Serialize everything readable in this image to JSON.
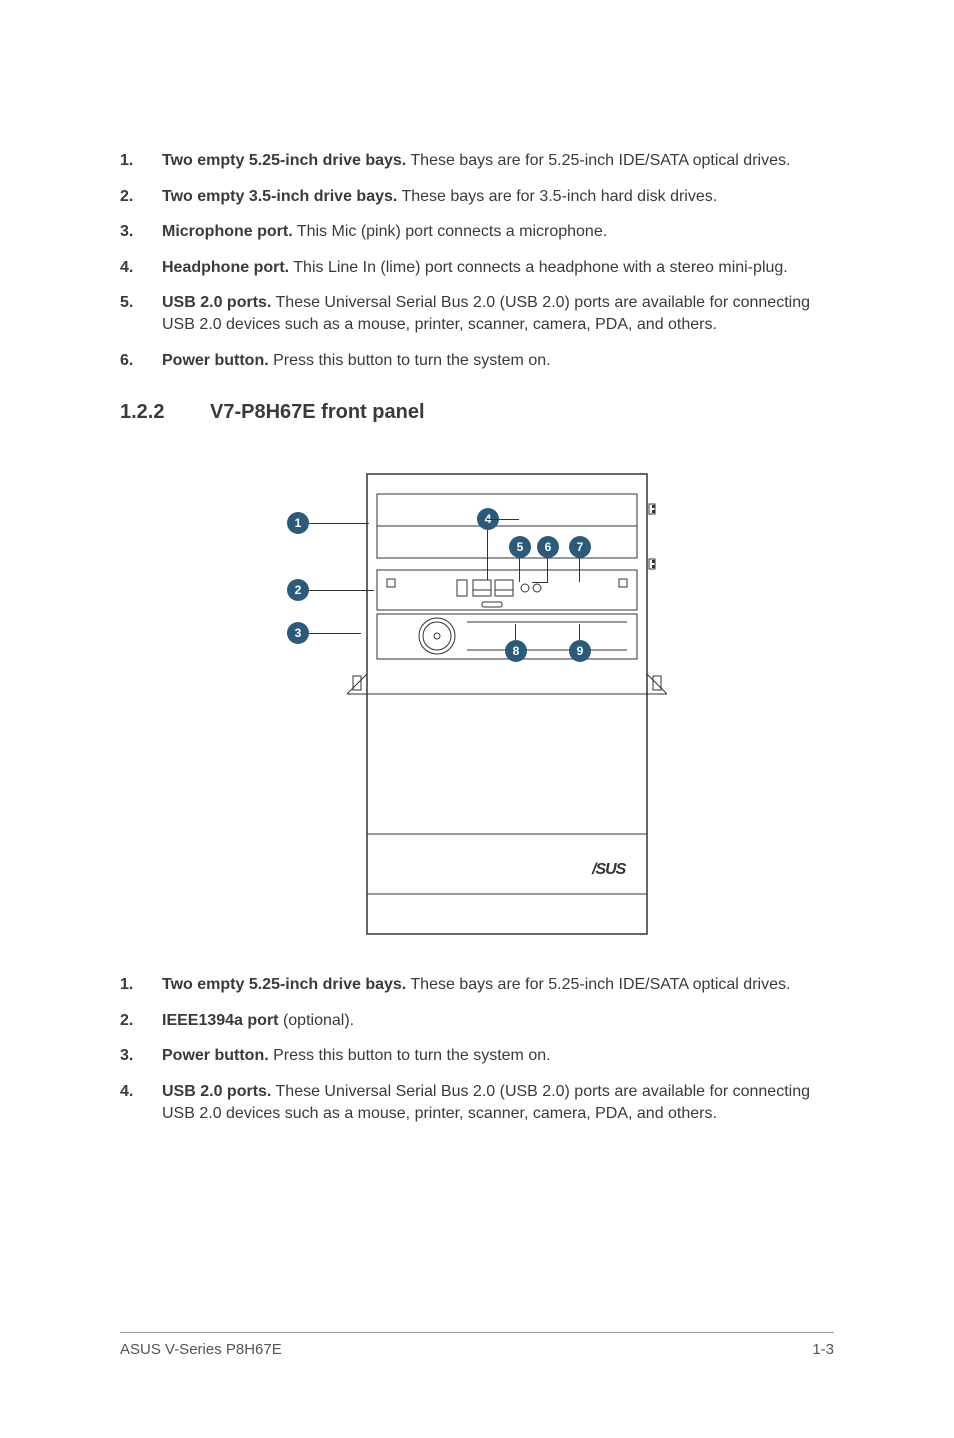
{
  "list_top": [
    {
      "n": "1.",
      "bold": "Two empty 5.25-inch drive bays.",
      "rest": " These bays are for 5.25-inch IDE/SATA optical drives."
    },
    {
      "n": "2.",
      "bold": "Two empty 3.5-inch drive bays.",
      "rest": " These bays are for 3.5-inch hard disk drives."
    },
    {
      "n": "3.",
      "bold": "Microphone port.",
      "rest": " This Mic (pink) port connects a microphone."
    },
    {
      "n": "4.",
      "bold": "Headphone port.",
      "rest": " This Line In (lime) port connects a headphone with a stereo mini-plug."
    },
    {
      "n": "5.",
      "bold": "USB 2.0 ports.",
      "rest": " These Universal Serial Bus 2.0 (USB 2.0) ports are available for connecting USB 2.0 devices such as a mouse, printer, scanner, camera, PDA, and others."
    },
    {
      "n": "6.",
      "bold": "Power button.",
      "rest": " Press this button to turn the system on."
    }
  ],
  "section": {
    "num": "1.2.2",
    "title": "V7-P8H67E front panel"
  },
  "callouts": {
    "c1": "1",
    "c2": "2",
    "c3": "3",
    "c4": "4",
    "c5": "5",
    "c6": "6",
    "c7": "7",
    "c8": "8",
    "c9": "9"
  },
  "list_bottom": [
    {
      "n": "1.",
      "bold": "Two empty 5.25-inch drive bays.",
      "rest": " These bays are for 5.25-inch IDE/SATA optical drives."
    },
    {
      "n": "2.",
      "bold": "IEEE1394a port",
      "rest": " (optional)."
    },
    {
      "n": "3.",
      "bold": "Power button.",
      "rest": " Press this button to turn the system on."
    },
    {
      "n": "4.",
      "bold": "USB 2.0 ports.",
      "rest": " These Universal Serial Bus 2.0 (USB 2.0) ports are available for connecting USB 2.0 devices such as a mouse, printer, scanner, camera, PDA, and others."
    }
  ],
  "footer": {
    "left": "ASUS V-Series P8H67E",
    "right": "1-3"
  }
}
